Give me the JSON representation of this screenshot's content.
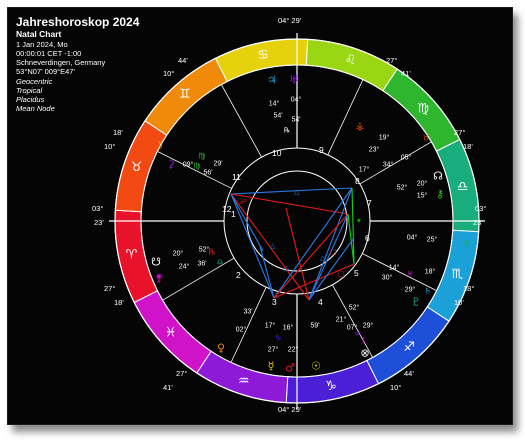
{
  "header": {
    "title": "Jahreshoroskop 2024",
    "chart_type": "Natal Chart",
    "date_line": "1 Jan 2024, Mo",
    "time_line": "00:00:01  CET -1:00",
    "place_line": "Schneverdingen, Germany",
    "coords_line": "53°N07' 009°E47'",
    "opt1": "Geocentric",
    "opt2": "Tropical",
    "opt3": "Placidus",
    "opt4": "Mean Node"
  },
  "outer_degrees": {
    "top": "04° 29'",
    "bottom": "04° 29'",
    "upper_left_a": "10°",
    "upper_left_b": "44'",
    "upper_right_a": "27°",
    "upper_right_b": "41'",
    "left_a": "18'",
    "left_b": "10°",
    "right_a": "27°",
    "right_b": "18'",
    "left_mid_a": "03°",
    "left_mid_b": "23'",
    "right_mid_a": "03°",
    "right_mid_b": "23'",
    "lower_left_a": "27°",
    "lower_left_b": "18'",
    "lower_right_a": "18°",
    "lower_right_b": "10'",
    "bottom_left_a": "27°",
    "bottom_left_b": "41'",
    "bottom_right_a": "44'",
    "bottom_right_b": "10°"
  },
  "houses": [
    "1",
    "2",
    "3",
    "4",
    "5",
    "6",
    "7",
    "8",
    "9",
    "10",
    "11",
    "12"
  ],
  "signs": [
    {
      "name": "Aries",
      "glyph": "♈",
      "color": "#e8122a"
    },
    {
      "name": "Taurus",
      "glyph": "♉",
      "color": "#f24a12"
    },
    {
      "name": "Gemini",
      "glyph": "♊",
      "color": "#f08a0a"
    },
    {
      "name": "Cancer",
      "glyph": "♋",
      "color": "#e6d20c"
    },
    {
      "name": "Leo",
      "glyph": "♌",
      "color": "#9ad614"
    },
    {
      "name": "Virgo",
      "glyph": "♍",
      "color": "#2eb72e"
    },
    {
      "name": "Libra",
      "glyph": "♎",
      "color": "#19ad7e"
    },
    {
      "name": "Scorpio",
      "glyph": "♏",
      "color": "#1ca0d8"
    },
    {
      "name": "Sagittarius",
      "glyph": "♐",
      "color": "#1e4fd8"
    },
    {
      "name": "Capricorn",
      "glyph": "♑",
      "color": "#4a1fd6"
    },
    {
      "name": "Aquarius",
      "glyph": "♒",
      "color": "#8c1ad6"
    },
    {
      "name": "Pisces",
      "glyph": "♓",
      "color": "#d012c8"
    }
  ],
  "planet_labels": {
    "top": [
      "14°",
      "04°",
      "54'",
      "54'",
      "℞"
    ],
    "upper_right": [
      "19°",
      "23°",
      "34°",
      "05°",
      "17°"
    ],
    "right": [
      "52°",
      "20°",
      "15°",
      "04°",
      "25°"
    ],
    "lower_right": [
      "14°",
      "30°",
      "29°",
      "18°"
    ],
    "bottom": [
      "33'",
      "02°",
      "17°",
      "16°",
      "27°",
      "22°",
      "59'",
      "52°",
      "21°",
      "07°",
      "29°"
    ],
    "left": [
      "09°",
      "29'",
      "56'",
      "20°",
      "52°",
      "24°",
      "36'"
    ]
  },
  "colors": {
    "background": "#050505",
    "aspect_blue": "#2a7be6",
    "aspect_red": "#e61a1a",
    "aspect_green": "#18d018"
  }
}
